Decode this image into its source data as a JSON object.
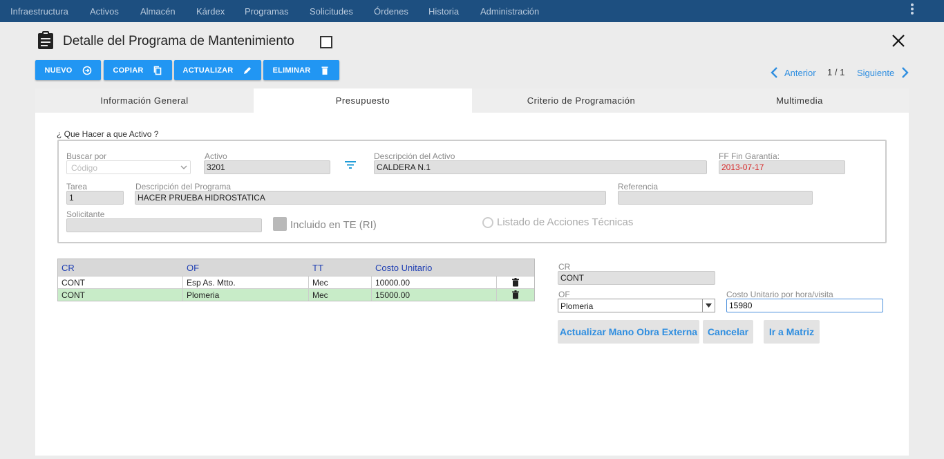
{
  "nav": {
    "items": [
      "Infraestructura",
      "Activos",
      "Almacén",
      "Kárdex",
      "Programas",
      "Solicitudes",
      "Órdenes",
      "Historia",
      "Administración"
    ]
  },
  "header": {
    "title": "Detalle del Programa de Mantenimiento"
  },
  "toolbar": {
    "nuevo": "NUEVO",
    "copiar": "COPIAR",
    "actualizar": "ACTUALIZAR",
    "eliminar": "ELIMINAR"
  },
  "pager": {
    "prev": "Anterior",
    "count": "1 / 1",
    "next": "Siguiente"
  },
  "tabs": [
    "Información General",
    "Presupuesto",
    "Criterio de Programación",
    "Multimedia"
  ],
  "form": {
    "legend": "¿ Que Hacer a que Activo ?",
    "buscar_label": "Buscar por",
    "buscar_value": "Código",
    "activo_label": "Activo",
    "activo_value": "3201",
    "desc_activo_label": "Descripción del Activo",
    "desc_activo_value": "CALDERA N.1",
    "garantia_label": "FF Fin Garantía:",
    "garantia_value": "2013-07-17",
    "tarea_label": "Tarea",
    "tarea_value": "1",
    "desc_programa_label": "Descripción del Programa",
    "desc_programa_value": "HACER PRUEBA HIDROSTATICA",
    "referencia_label": "Referencia",
    "referencia_value": "",
    "solicitante_label": "Solicitante",
    "solicitante_value": "",
    "incluido_label": "Incluido en TE (RI)",
    "listado_label": "Listado de Acciones Técnicas"
  },
  "grid": {
    "headers": [
      "CR",
      "OF",
      "TT",
      "Costo Unitario"
    ],
    "rows": [
      {
        "cr": "CONT",
        "of": "Esp As. Mtto.",
        "tt": "Mec",
        "costo": "10000.00"
      },
      {
        "cr": "CONT",
        "of": "Plomeria",
        "tt": "Mec",
        "costo": "15000.00"
      }
    ]
  },
  "edit": {
    "cr_label": "CR",
    "cr_value": "CONT",
    "of_label": "OF",
    "of_value": "Plomeria",
    "costo_label": "Costo Unitario por hora/visita",
    "costo_value": "15980",
    "btn_actualizar": "Actualizar Mano Obra Externa",
    "btn_cancelar": "Cancelar",
    "btn_matriz": "Ir a Matriz"
  },
  "colors": {
    "nav_bg": "#1d4f80",
    "primary": "#2196f3",
    "link": "#2f8ee0",
    "selected_row": "#c8ecc8",
    "warning_text": "#d62a2a"
  }
}
